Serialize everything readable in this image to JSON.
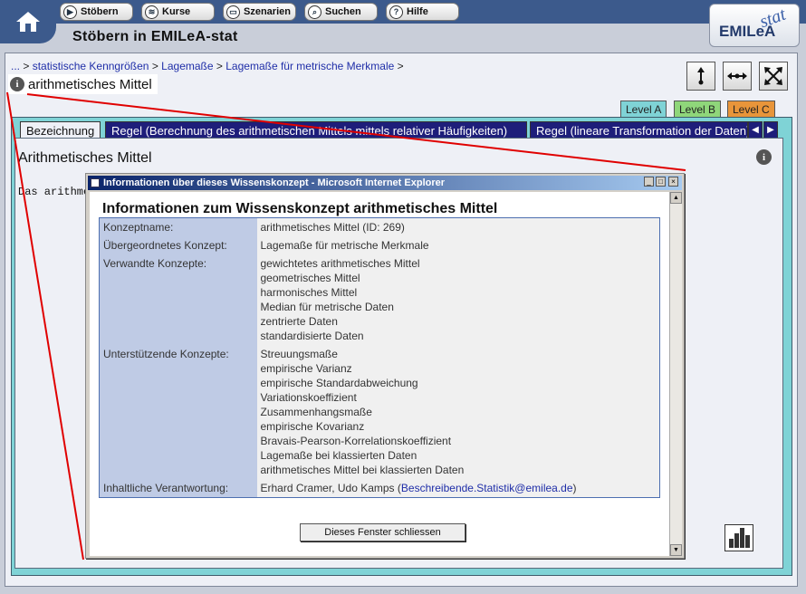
{
  "nav": {
    "buttons": [
      {
        "label": "Stöbern",
        "icon": "play-icon"
      },
      {
        "label": "Kurse",
        "icon": "kurse-icon"
      },
      {
        "label": "Szenarien",
        "icon": "szenarien-icon"
      },
      {
        "label": "Suchen",
        "icon": "search-icon"
      },
      {
        "label": "Hilfe",
        "icon": "help-icon"
      }
    ]
  },
  "header": {
    "title": "Stöbern in EMILeA-stat",
    "logo_text": "EMILeA",
    "logo_suffix": "stat"
  },
  "breadcrumb": {
    "items": [
      "...",
      "statistische Kenngrößen",
      "Lagemaße",
      "Lagemaße für metrische Merkmale"
    ],
    "separator": ">",
    "current": "arithmetisches Mittel"
  },
  "levels": [
    {
      "label": "Level A",
      "color": "#7fd3d6"
    },
    {
      "label": "Level B",
      "color": "#8fd67a"
    },
    {
      "label": "Level C",
      "color": "#e8953a"
    }
  ],
  "tabs": [
    {
      "label": "Bezeichnung"
    },
    {
      "label": "Regel (Berechnung des arithmetischen Mittels mittels relativer Häufigkeiten)"
    },
    {
      "label": "Regel (lineare Transformation der Daten)"
    }
  ],
  "content": {
    "title": "Arithmetisches Mittel",
    "text": "Das arithme"
  },
  "popup": {
    "window_title": "Informationen über dieses Wissenskonzept - Microsoft Internet Explorer",
    "heading": "Informationen zum Wissenskonzept arithmetisches Mittel",
    "rows": {
      "konzeptname": {
        "key": "Konzeptname:",
        "value": "arithmetisches Mittel (ID: 269)"
      },
      "uebergeordnet": {
        "key": "Übergeordnetes Konzept:",
        "value": "Lagemaße für metrische Merkmale"
      },
      "verwandt": {
        "key": "Verwandte Konzepte:",
        "values": [
          "gewichtetes arithmetisches Mittel",
          "geometrisches Mittel",
          "harmonisches Mittel",
          "Median für metrische Daten",
          "zentrierte Daten",
          "standardisierte Daten"
        ]
      },
      "unterstuetzend": {
        "key": "Unterstützende Konzepte:",
        "values": [
          "Streuungsmaße",
          "empirische Varianz",
          "empirische Standardabweichung",
          "Variationskoeffizient",
          "Zusammenhangsmaße",
          "empirische Kovarianz",
          "Bravais-Pearson-Korrelationskoeffizient",
          "Lagemaße bei klassierten Daten",
          "arithmetisches Mittel bei klassierten Daten"
        ]
      },
      "verantwortung": {
        "key": "Inhaltliche Verantwortung:",
        "value": "Erhard Cramer, Udo Kamps",
        "paren_open": "(",
        "email": "Beschreibende.Statistik@emilea.de",
        "paren_close": ")"
      }
    },
    "close_label": "Dieses Fenster schliessen"
  },
  "colors": {
    "nav_blue": "#3c5a8c",
    "tab_dark": "#1e1e7a",
    "panel_teal": "#7fd3d6",
    "table_key": "#bfcbe5",
    "annotation_red": "#e00000"
  }
}
